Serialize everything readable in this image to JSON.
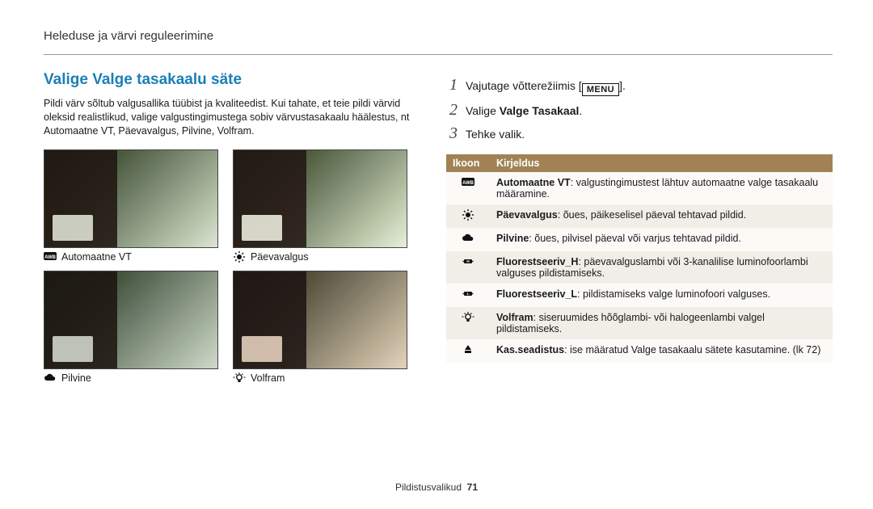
{
  "header": "Heleduse ja värvi reguleerimine",
  "title": "Valige Valge tasakaalu säte",
  "intro": "Pildi värv sõltub valgusallika tüübist ja kvaliteedist. Kui tahate, et teie pildi värvid oleksid realistlikud, valige valgustingimustega sobiv värvustasakaalu häälestus, nt Automaatne VT, Päevavalgus, Pilvine, Volfram.",
  "thumbs": [
    {
      "label": "Automaatne VT",
      "icon": "awb-icon",
      "cls": ""
    },
    {
      "label": "Päevavalgus",
      "icon": "sun-icon",
      "cls": "wb-daylight"
    },
    {
      "label": "Pilvine",
      "icon": "cloud-icon",
      "cls": "wb-cloudy"
    },
    {
      "label": "Volfram",
      "icon": "bulb-icon",
      "cls": "wb-tungsten"
    }
  ],
  "steps": {
    "s1": {
      "num": "1",
      "pre": "Vajutage võtterežiimis [",
      "menu": "MENU",
      "post": "]."
    },
    "s2": {
      "num": "2",
      "pre": "Valige ",
      "bold": "Valge Tasakaal",
      "post": "."
    },
    "s3": {
      "num": "3",
      "txt": "Tehke valik."
    }
  },
  "table": {
    "head": {
      "c1": "Ikoon",
      "c2": "Kirjeldus"
    },
    "rows": [
      {
        "icon": "awb-icon",
        "bold": "Automaatne VT",
        "rest": ": valgustingimustest lähtuv automaatne valge tasakaalu määramine."
      },
      {
        "icon": "sun-icon",
        "bold": "Päevavalgus",
        "rest": ": õues, päikeselisel päeval tehtavad pildid."
      },
      {
        "icon": "cloud-icon",
        "bold": "Pilvine",
        "rest": ": õues, pilvisel päeval või varjus tehtavad pildid."
      },
      {
        "icon": "fluor-h-icon",
        "bold": "Fluorestseeriv_H",
        "rest": ": päevavalguslambi või 3-kanalilise luminofoorlambi valguses pildistamiseks."
      },
      {
        "icon": "fluor-l-icon",
        "bold": "Fluorestseeriv_L",
        "rest": ": pildistamiseks valge luminofoori valguses."
      },
      {
        "icon": "bulb-icon",
        "bold": "Volfram",
        "rest": ": siseruumides hõõglambi- või halogeenlambi valgel pildistamiseks."
      },
      {
        "icon": "custom-icon",
        "bold": "Kas.seadistus",
        "rest": ": ise määratud Valge tasakaalu sätete kasutamine. (lk 72)"
      }
    ]
  },
  "footer": {
    "label": "Pildistusvalikud",
    "page": "71"
  }
}
